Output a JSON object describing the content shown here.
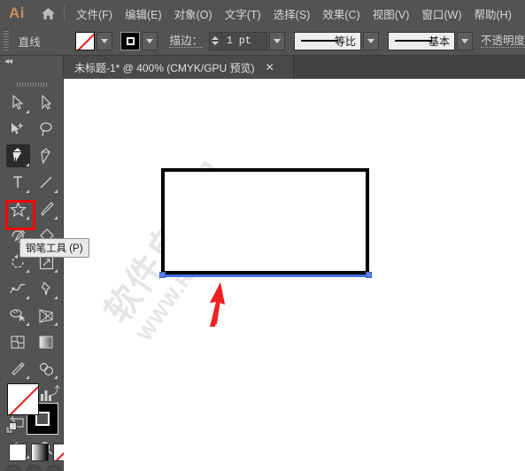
{
  "app": {
    "logo_text": "Ai",
    "home_icon": "home-icon"
  },
  "menubar": {
    "items": [
      {
        "label": "文件(F)"
      },
      {
        "label": "编辑(E)"
      },
      {
        "label": "对象(O)"
      },
      {
        "label": "文字(T)"
      },
      {
        "label": "选择(S)"
      },
      {
        "label": "效果(C)"
      },
      {
        "label": "视图(V)"
      },
      {
        "label": "窗口(W)"
      },
      {
        "label": "帮助(H)"
      }
    ]
  },
  "controlbar": {
    "selection_label": "直线",
    "fill_swatch": "none-swatch",
    "stroke_swatch": "black-stroke-swatch",
    "stroke_label": "描边：",
    "stroke_weight": "1 pt",
    "profile_label": "等比",
    "brush_label": "基本",
    "opacity_label": "不透明度"
  },
  "tabbar": {
    "collapse_icon": "double-chevron-left-icon",
    "document_title": "未标题-1* @ 400% (CMYK/GPU 预览)",
    "close_label": "✕"
  },
  "toolpanel": {
    "tools": [
      {
        "name": "selection-tool",
        "icon": "arrow-cursor-icon",
        "has_flyout": true
      },
      {
        "name": "direct-selection-tool",
        "icon": "white-arrow-icon",
        "has_flyout": false
      },
      {
        "name": "magic-wand-tool",
        "icon": "magic-wand-icon",
        "has_flyout": false
      },
      {
        "name": "lasso-tool",
        "icon": "lasso-icon",
        "has_flyout": false
      },
      {
        "name": "pen-tool",
        "icon": "pen-icon",
        "has_flyout": true,
        "active": true
      },
      {
        "name": "curvature-tool",
        "icon": "curvature-pen-icon",
        "has_flyout": false
      },
      {
        "name": "type-tool",
        "icon": "type-T-icon",
        "has_flyout": true
      },
      {
        "name": "line-segment-tool",
        "icon": "line-segment-icon",
        "has_flyout": true
      },
      {
        "name": "shape-tool",
        "icon": "star-shape-icon",
        "has_flyout": true
      },
      {
        "name": "paintbrush-tool",
        "icon": "paintbrush-icon",
        "has_flyout": true
      },
      {
        "name": "shaper-tool",
        "icon": "shaper-pencil-icon",
        "has_flyout": true
      },
      {
        "name": "eraser-tool",
        "icon": "eraser-icon",
        "has_flyout": true
      },
      {
        "name": "rotate-tool",
        "icon": "rotate-icon",
        "has_flyout": true
      },
      {
        "name": "scale-tool",
        "icon": "scale-icon",
        "has_flyout": true
      },
      {
        "name": "width-tool",
        "icon": "width-warp-icon",
        "has_flyout": true
      },
      {
        "name": "free-transform-tool",
        "icon": "pushpin-icon",
        "has_flyout": true
      },
      {
        "name": "shape-builder-tool",
        "icon": "shape-builder-icon",
        "has_flyout": true
      },
      {
        "name": "perspective-grid-tool",
        "icon": "perspective-grid-icon",
        "has_flyout": true
      },
      {
        "name": "mesh-tool",
        "icon": "mesh-icon",
        "has_flyout": false
      },
      {
        "name": "gradient-tool",
        "icon": "gradient-icon",
        "has_flyout": false
      },
      {
        "name": "eyedropper-tool",
        "icon": "eyedropper-icon",
        "has_flyout": true
      },
      {
        "name": "blend-tool",
        "icon": "blend-icon",
        "has_flyout": true
      },
      {
        "name": "symbol-sprayer-tool",
        "icon": "symbol-sprayer-icon",
        "has_flyout": true
      },
      {
        "name": "column-graph-tool",
        "icon": "bar-graph-icon",
        "has_flyout": true
      },
      {
        "name": "artboard-tool",
        "icon": "artboard-icon",
        "has_flyout": false
      },
      {
        "name": "slice-tool",
        "icon": "slice-knife-icon",
        "has_flyout": true
      },
      {
        "name": "hand-tool",
        "icon": "hand-icon",
        "has_flyout": true
      },
      {
        "name": "zoom-tool",
        "icon": "magnifier-icon",
        "has_flyout": false
      }
    ],
    "tooltip": "钢笔工具 (P)",
    "highlight_color": "#ff0000",
    "fill_stroke": {
      "fill": "none",
      "stroke": "black",
      "swap_icon": "swap-arrow-icon",
      "default_icon": "default-fill-stroke-icon",
      "modes": [
        "color-mode",
        "gradient-mode",
        "none-mode"
      ]
    }
  },
  "canvas": {
    "watermark_line1": "软件自学网",
    "watermark_line2": "WWW.RJZXW.COM",
    "shape": {
      "name": "rectangle",
      "fill": "#ffffff",
      "stroke": "#000000",
      "selected_edge": "bottom",
      "selection_color": "#3f6fe0"
    },
    "annotation": {
      "name": "red-arrow",
      "color": "#ee2020",
      "points_to": "bottom-edge-of-rectangle"
    }
  }
}
